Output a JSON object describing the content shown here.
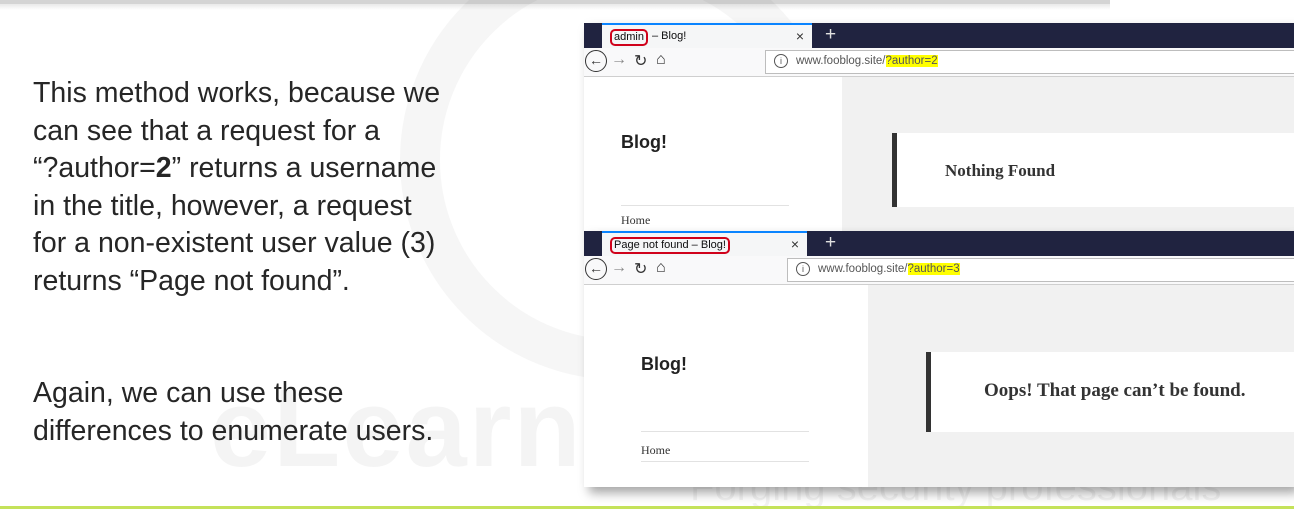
{
  "slide": {
    "paragraph1": {
      "line1": "This method works, because we",
      "line2": "can see that a request for a",
      "line3_pre": "“?author=",
      "line3_bold": "2",
      "line3_post": "” returns a username",
      "line4": "in the title, however, a request",
      "line5": "for a non-existent user value (3)",
      "line6": "returns “Page not found”."
    },
    "paragraph2": {
      "line1": "Again, we can use these",
      "line2": "differences to enumerate users."
    },
    "watermark": {
      "brand": "eLearn",
      "tagline": "Forging security professionals"
    }
  },
  "browser_top": {
    "tab_title_highlight": "admin",
    "tab_title_rest": " – Blog!",
    "tab_close": "×",
    "new_tab": "+",
    "url_base": "www.fooblog.site/",
    "url_query": "?author=2",
    "blog_title": "Blog!",
    "sidebar_link": "Home",
    "notice": "Nothing Found"
  },
  "browser_bottom": {
    "tab_title": "Page not found – Blog!",
    "tab_close": "×",
    "new_tab": "+",
    "url_base": "www.fooblog.site/",
    "url_query": "?author=3",
    "blog_title": "Blog!",
    "sidebar_link": "Home",
    "notice": "Oops! That page can’t be found."
  },
  "icons": {
    "back": "back-arrow-icon",
    "forward": "forward-arrow-icon",
    "reload": "reload-icon",
    "home": "home-icon",
    "info": "info-icon"
  },
  "colors": {
    "accent_line": "#c4e25a",
    "tab_bar": "#202340",
    "highlight_box": "#d0021b",
    "url_highlight": "#ffff00"
  }
}
